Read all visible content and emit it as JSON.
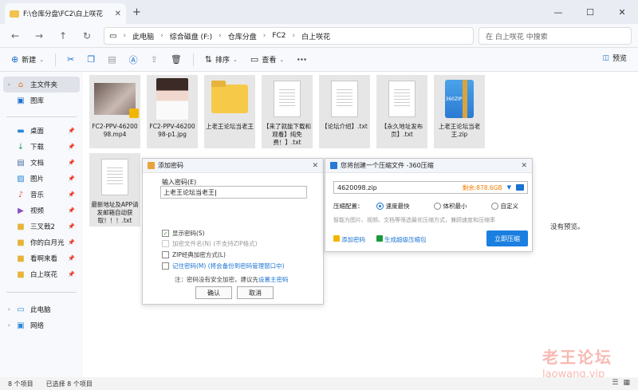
{
  "window": {
    "tab_title": "F:\\仓库分盘\\FC2\\白上咲花",
    "new_tab": "+",
    "close_tab": "✕",
    "minimize": "—",
    "maximize": "☐",
    "close": "✕"
  },
  "address": {
    "breadcrumbs": [
      "此电脑",
      "综合磁盘 (F:)",
      "仓库分盘",
      "FC2",
      "白上咲花"
    ],
    "search_placeholder": "在 白上咲花 中搜索"
  },
  "toolbar": {
    "new_label": "新建",
    "sort_label": "排序",
    "view_label": "查看",
    "more_label": "···",
    "preview_label": "预览"
  },
  "sidebar": {
    "quick": [
      {
        "label": "主文件夹",
        "icon": "home-icon"
      },
      {
        "label": "图库",
        "icon": "gallery-icon"
      }
    ],
    "pinned": [
      {
        "label": "桌面",
        "icon": "desktop-icon"
      },
      {
        "label": "下载",
        "icon": "download-icon"
      },
      {
        "label": "文档",
        "icon": "document-icon"
      },
      {
        "label": "图片",
        "icon": "picture-icon"
      },
      {
        "label": "音乐",
        "icon": "music-icon"
      },
      {
        "label": "视频",
        "icon": "video-icon"
      },
      {
        "label": "三叉戟2",
        "icon": "folder-icon"
      },
      {
        "label": "你的白月光",
        "icon": "folder-icon"
      },
      {
        "label": "看啊来看",
        "icon": "folder-icon"
      },
      {
        "label": "白上咲花",
        "icon": "folder-icon"
      }
    ],
    "drives": [
      {
        "label": "此电脑",
        "icon": "computer-icon"
      },
      {
        "label": "网络",
        "icon": "network-icon"
      }
    ]
  },
  "files": [
    {
      "name": "FC2-PPV-4620098.mp4",
      "kind": "video"
    },
    {
      "name": "FC2-PPV-4620098-p1.jpg",
      "kind": "photo"
    },
    {
      "name": "上老王论坛当老王",
      "kind": "folder"
    },
    {
      "name": "【来了就能下载和观看】纯免费！】.txt",
      "kind": "txt"
    },
    {
      "name": "【论坛介绍】.txt",
      "kind": "txt"
    },
    {
      "name": "【永久地址发布页】.txt",
      "kind": "txt"
    },
    {
      "name": "上老王论坛当老王.zip",
      "kind": "zip"
    },
    {
      "name": "最新地址及APP请发邮箱自动获取！！！.txt",
      "kind": "txt"
    }
  ],
  "zip_icon_text": "360ZIP",
  "no_preview": "没有预览。",
  "watermark": {
    "line1": "老王论坛",
    "line2": "laowang.vip"
  },
  "status": {
    "count": "8 个项目",
    "selected": "已选择 8 个项目"
  },
  "password_dialog": {
    "title": "添加密码",
    "input_label": "输入密码(E)",
    "input_value": "上老王论坛当老王",
    "show_password": "显示密码(S)",
    "encrypt_names": "加密文件名(N) (不支持ZIP格式)",
    "zip_classic": "ZIP经典加密方式(L)",
    "remember": "记住密码(M) (将会备份到密码管理窗口中)",
    "note_prefix": "注：密码没有安全加密，建议先",
    "note_link": "设置主密码",
    "ok": "确认",
    "cancel": "取消"
  },
  "zip_dialog": {
    "title": "您将创建一个压缩文件 -360压缩",
    "filename": "4620098.zip",
    "free_space": "剩余:878.6GB",
    "config_label": "压缩配置：",
    "options": [
      "速度最快",
      "体积最小",
      "自定义"
    ],
    "hint": "智能为图片、视频、文档等筛选最优压缩方式，兼顾速度和压缩率",
    "add_password": "添加密码",
    "make_sfx": "生成超级压缩包",
    "start": "立即压缩"
  }
}
